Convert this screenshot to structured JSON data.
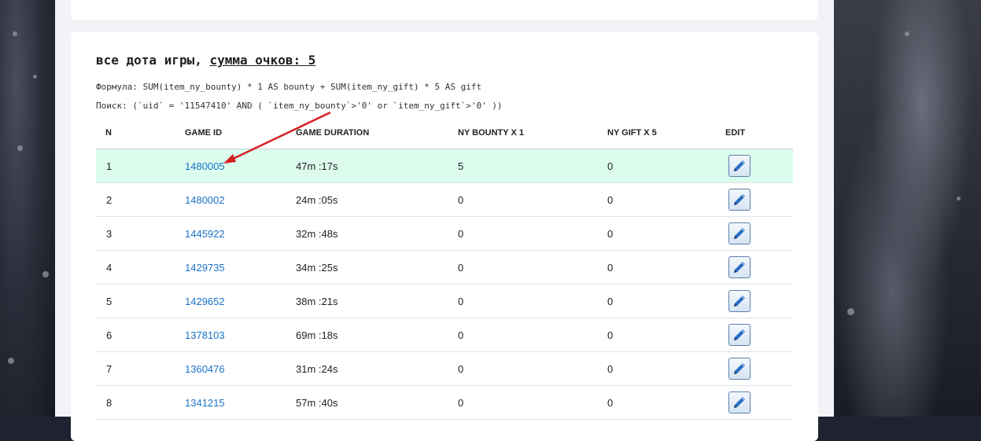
{
  "heading": {
    "prefix": "все дота игры, ",
    "score_label": "сумма очков: 5"
  },
  "formula_line": "Формула: SUM(item_ny_bounty) * 1 AS bounty + SUM(item_ny_gift) * 5 AS gift",
  "search_line": "Поиск: (`uid` = '11547410' AND ( `item_ny_bounty`>'0' or `item_ny_gift`>'0' ))",
  "table": {
    "headers": [
      "N",
      "GAME ID",
      "GAME DURATION",
      "NY BOUNTY X 1",
      "NY GIFT X 5",
      "EDIT"
    ],
    "rows": [
      {
        "n": "1",
        "game_id": "1480005",
        "duration": "47m :17s",
        "bounty": "5",
        "gift": "0"
      },
      {
        "n": "2",
        "game_id": "1480002",
        "duration": "24m :05s",
        "bounty": "0",
        "gift": "0"
      },
      {
        "n": "3",
        "game_id": "1445922",
        "duration": "32m :48s",
        "bounty": "0",
        "gift": "0"
      },
      {
        "n": "4",
        "game_id": "1429735",
        "duration": "34m :25s",
        "bounty": "0",
        "gift": "0"
      },
      {
        "n": "5",
        "game_id": "1429652",
        "duration": "38m :21s",
        "bounty": "0",
        "gift": "0"
      },
      {
        "n": "6",
        "game_id": "1378103",
        "duration": "69m :18s",
        "bounty": "0",
        "gift": "0"
      },
      {
        "n": "7",
        "game_id": "1360476",
        "duration": "31m :24s",
        "bounty": "0",
        "gift": "0"
      },
      {
        "n": "8",
        "game_id": "1341215",
        "duration": "57m :40s",
        "bounty": "0",
        "gift": "0"
      }
    ]
  },
  "edit_icon": "pencil-icon",
  "colors": {
    "link": "#1a73c8",
    "highlight_row": "#dcfcee",
    "annotation_arrow": "#d42020"
  }
}
